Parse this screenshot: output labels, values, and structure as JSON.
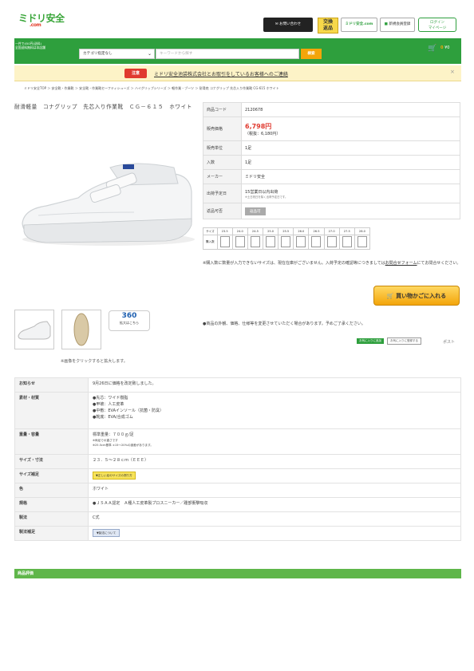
{
  "header": {
    "logo_main": "ミドリ安全",
    "logo_sub": ".com",
    "contact_button": "お問い合わせ",
    "contact_sub": "フォーム・電話・FAX",
    "exchange_label_top": "交換",
    "exchange_label_bottom": "返品",
    "corporate_label": "ミドリ安全.com",
    "member_label": "新規会員登録",
    "login_label_top": "ログイン",
    "login_label_bottom": "マイページ"
  },
  "searchbar": {
    "promo_line1": "一件で450円(送料)",
    "promo_line2": "全国送料無料は本店舗",
    "category_select": "カテゴリ指定なし",
    "keyword_placeholder": "キーワードから探す",
    "search_button": "検索",
    "cart_count": "0",
    "cart_total": "¥0"
  },
  "notice": {
    "badge": "注意",
    "text": "ミドリ安全池袋株式会社とお取引をしているお客様へのご連絡"
  },
  "breadcrumb": "ミドリ安全TOP ＞ 安全靴・作業靴 ＞ 安全靴・作業靴セーフティシューズ ＞ ハイグリップシリーズ ＞ 軽作業・ブーツ ＞ 耐滑底  コナグリップ  先芯入り作業靴  CG-615  ホワイト",
  "product": {
    "title": "耐滑軽量　コナグリップ　先芯入り作業靴　ＣＧ－６１５　ホワイト",
    "click_hint": "※画像をクリックすると拡大します。",
    "view360_label": "360",
    "view360_sub": "拡大はこちら"
  },
  "spec": {
    "code_label": "商品コード",
    "code_value": "2120678",
    "price_label": "販売価格",
    "price_value": "6,798円",
    "price_tax": "（税抜：6,180円）",
    "unit_label": "販売単位",
    "unit_value": "1足",
    "qty_label": "入数",
    "qty_value": "1足",
    "maker_label": "メーカー",
    "maker_value": "ミドリ安全",
    "ship_label": "出荷予定日",
    "ship_value": "15営業日以内出荷",
    "ship_note": "※土日祝日を除く出荷予定日です。",
    "return_label": "返品可否",
    "return_value": "返品可"
  },
  "sizes": {
    "size_header": "サイズ",
    "qty_header": "購入数",
    "values": [
      "23.5",
      "24.0",
      "24.5",
      "25.0",
      "25.5",
      "26.0",
      "26.5",
      "27.0",
      "27.5",
      "28.0"
    ]
  },
  "notes": {
    "stock_note": "※購入数に数量が入力できないサイズは、現在在庫がございません。入荷予定の確認等につきましては",
    "stock_link": "お問合せフォーム",
    "stock_note_end": "にてお問合せください。",
    "change_note": "●商品の外観、価格、仕様等を変更させていただく場合があります。予めご了承ください。"
  },
  "actions": {
    "add_to_cart": "買い物かごに入れる",
    "tag_favorite": "お気に入りに追加",
    "tag_compare": "お気に入りに登録する",
    "post": "ポスト"
  },
  "details": [
    {
      "key": "お知らせ",
      "lines": [
        "9月26日に価格を改定致しました。"
      ]
    },
    {
      "key": "素材・材質",
      "lines": [
        "●先芯：ワイド樹脂",
        "●甲被：人工皮革",
        "●中敷：EVAインソール（抗菌・防臭）",
        "●靴底：EVA/合成ゴム"
      ]
    },
    {
      "key": "重量・容量",
      "lines": [
        "標準重量：７００ｇ/足"
      ],
      "notes": [
        "※両足での重さです",
        "※25.5cm基準 ±15〜20%の誤差があります。"
      ]
    },
    {
      "key": "サイズ・寸法",
      "lines": [
        "２３．５～２８ｃｍ（ＥＥＥ）"
      ]
    },
    {
      "key": "サイズ補足",
      "button": "▼正しい足のサイズの測り方"
    },
    {
      "key": "色",
      "lines": [
        "ホワイト"
      ]
    },
    {
      "key": "規格",
      "lines": [
        "●ＪＳＡＡ認定　Ａ種人工皮革製プロスニーカー／踵部衝撃吸収"
      ]
    },
    {
      "key": "製法",
      "lines": [
        "C式"
      ]
    },
    {
      "key": "製法補足",
      "button2": "▼製法について"
    }
  ],
  "review_title": "商品評価"
}
